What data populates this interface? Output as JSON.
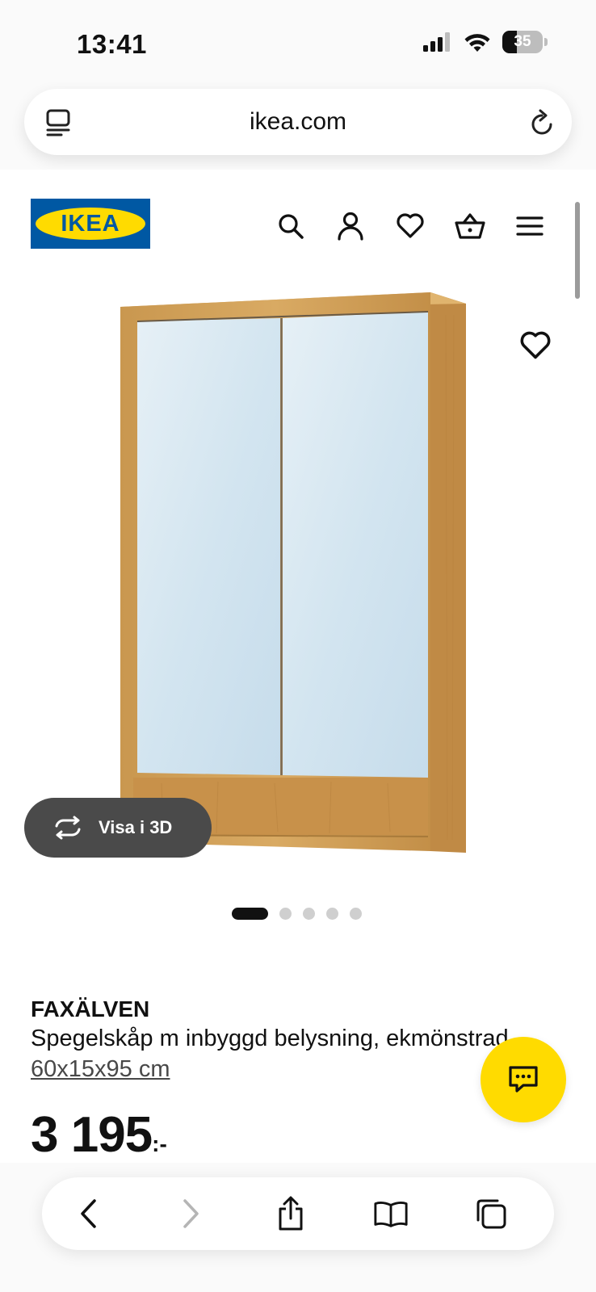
{
  "status_bar": {
    "time": "13:41",
    "battery_level": "35",
    "icons": [
      "cellular-signal-icon",
      "wifi-icon",
      "battery-icon"
    ]
  },
  "browser": {
    "url": "ikea.com",
    "icons": [
      "reader-mode-icon",
      "reload-icon"
    ]
  },
  "site_header": {
    "logo_text": "IKEA",
    "icons": [
      "search-icon",
      "account-icon",
      "heart-icon",
      "shopping-basket-icon",
      "hamburger-menu-icon"
    ]
  },
  "product": {
    "image_icon": "mirror-cabinet-image",
    "view_3d_label": "Visa i 3D",
    "carousel": {
      "total": 5,
      "active": 1
    },
    "name": "FAXÄLVEN",
    "description": "Spegelskåp m inbyggd belysning, ekmönstrad,",
    "size": "60x15x95 cm",
    "price": "3 195",
    "price_suffix": ":-"
  },
  "bottom_toolbar": {
    "icons": [
      "back-icon",
      "forward-icon",
      "share-icon",
      "bookmarks-icon",
      "tabs-icon"
    ]
  },
  "colors": {
    "ikea_blue": "#0058a3",
    "ikea_yellow": "#ffdb00",
    "dark_pill": "#4a4a4a"
  }
}
